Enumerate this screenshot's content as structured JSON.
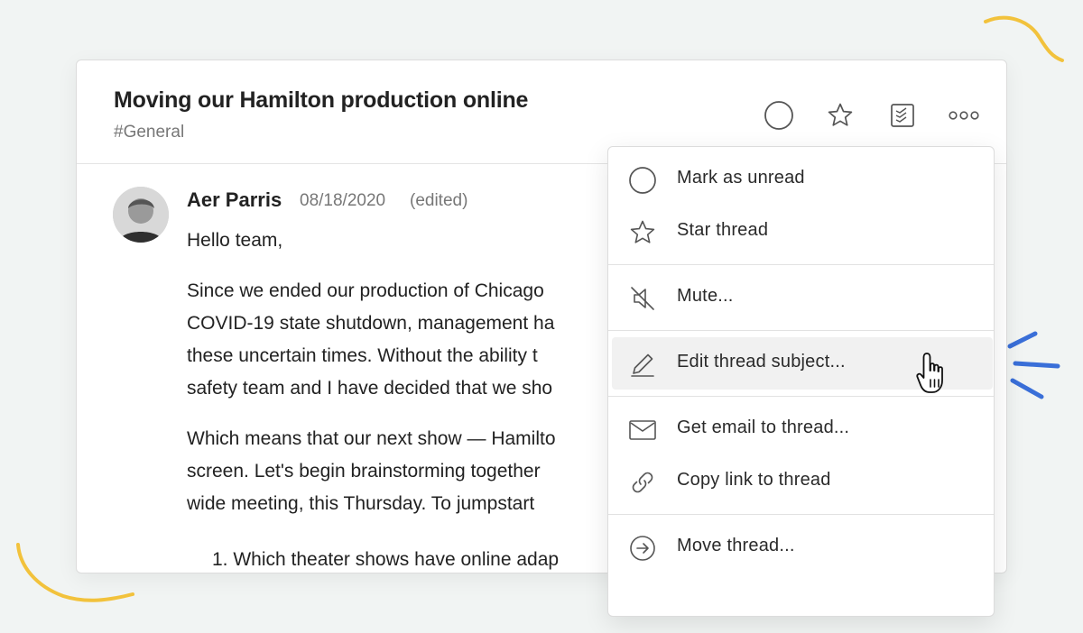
{
  "thread": {
    "title": "Moving our Hamilton production online",
    "channel": "#General"
  },
  "header_actions": [
    {
      "icon": "circle-icon"
    },
    {
      "icon": "star-icon"
    },
    {
      "icon": "checklist-icon"
    },
    {
      "icon": "more-options-icon"
    }
  ],
  "message": {
    "author": "Aer Parris",
    "date": "08/18/2020",
    "edited": "(edited)",
    "greeting": "Hello team,",
    "paragraph1": [
      "Since we ended our production of Chicago",
      "COVID-19 state shutdown, management ha",
      "these uncertain times. Without the ability t",
      "safety team and I have decided that we sho"
    ],
    "paragraph2": [
      "Which means that our next show — Hamilto",
      "screen. Let's begin brainstorming together",
      "wide meeting, this Thursday. To jumpstart"
    ],
    "list_item1": "1. Which theater shows have online adap"
  },
  "menu": {
    "items": [
      {
        "label": "Mark as unread",
        "icon": "circle-icon"
      },
      {
        "label": "Star thread",
        "icon": "star-icon"
      },
      {
        "label": "Mute...",
        "icon": "mute-icon"
      },
      {
        "label": "Edit thread subject...",
        "icon": "pencil-icon",
        "highlighted": true
      },
      {
        "label": "Get email to thread...",
        "icon": "envelope-icon"
      },
      {
        "label": "Copy link to thread",
        "icon": "link-icon"
      },
      {
        "label": "Move thread...",
        "icon": "arrow-circle-icon"
      }
    ]
  },
  "colors": {
    "background": "#f1f4f3",
    "accent_yellow": "#f2c23c",
    "accent_blue": "#3a6fd8",
    "highlight": "#f1f1f1"
  }
}
